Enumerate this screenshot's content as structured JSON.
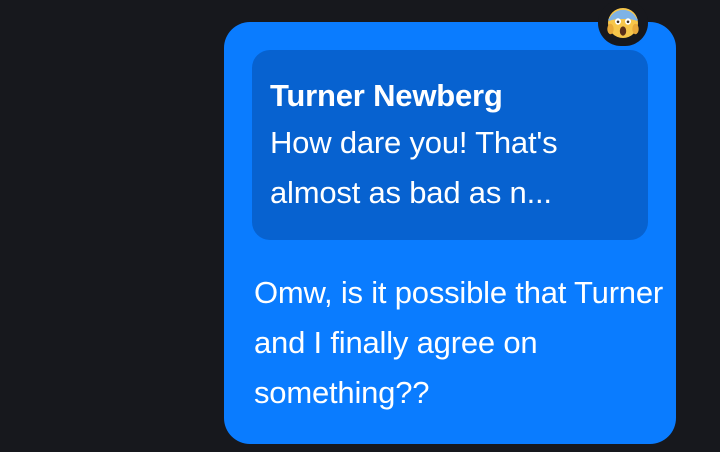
{
  "message": {
    "quoted_reply": {
      "author": "Turner Newberg",
      "text": "How dare you! That's almost as bad as n..."
    },
    "text": "Omw, is it possible that Turner and I finally agree on something??",
    "reaction": {
      "icon": "screaming-face-emoji-icon"
    }
  },
  "colors": {
    "background": "#17181d",
    "bubble": "#0a7cff",
    "quoted_bubble": "#0762d0",
    "text": "#ffffff"
  }
}
